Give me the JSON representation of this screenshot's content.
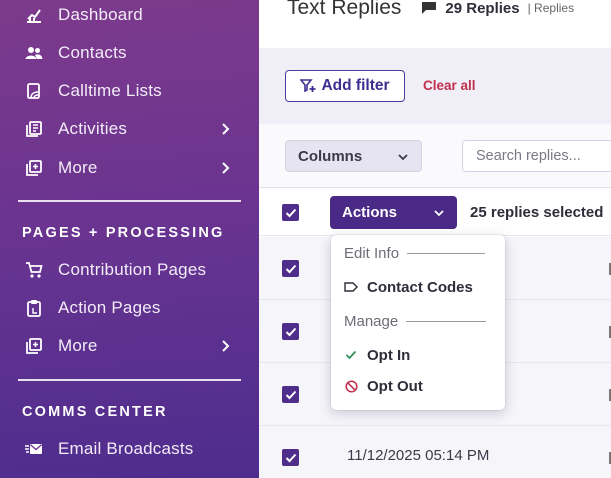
{
  "sidebar": {
    "top_items": [
      {
        "label": "Dashboard",
        "icon": "dashboard-icon"
      },
      {
        "label": "Contacts",
        "icon": "contacts-icon"
      },
      {
        "label": "Calltime Lists",
        "icon": "calltime-icon"
      },
      {
        "label": "Activities",
        "icon": "activities-icon"
      },
      {
        "label": "More",
        "icon": "more-icon"
      }
    ],
    "sections": [
      {
        "title": "PAGES + PROCESSING",
        "items": [
          {
            "label": "Contribution Pages",
            "icon": "cart-icon"
          },
          {
            "label": "Action Pages",
            "icon": "clipboard-icon"
          },
          {
            "label": "More",
            "icon": "more-icon"
          }
        ]
      },
      {
        "title": "COMMS CENTER",
        "items": [
          {
            "label": "Email Broadcasts",
            "icon": "email-icon"
          }
        ]
      }
    ]
  },
  "header": {
    "title": "Text Replies",
    "count": "29 Replies",
    "sub": "| Replies"
  },
  "filters": {
    "add_label": "Add filter",
    "clear_label": "Clear all"
  },
  "toolbar": {
    "columns_label": "Columns",
    "search_placeholder": "Search replies..."
  },
  "table": {
    "actions_label": "Actions",
    "selected_text": "25 replies selected",
    "visible_date": "11/12/2025 05:14 PM"
  },
  "dropdown": {
    "groups": [
      {
        "label": "Edit Info",
        "items": [
          {
            "label": "Contact Codes",
            "icon": "tag-icon"
          }
        ]
      },
      {
        "label": "Manage",
        "items": [
          {
            "label": "Opt In",
            "icon": "check-icon"
          },
          {
            "label": "Opt Out",
            "icon": "ban-icon"
          }
        ]
      }
    ]
  },
  "colors": {
    "brand_purple": "#4a2a86",
    "accent_red": "#c2304e",
    "opt_in_green": "#2e8b57",
    "opt_out_red": "#c2304e"
  }
}
